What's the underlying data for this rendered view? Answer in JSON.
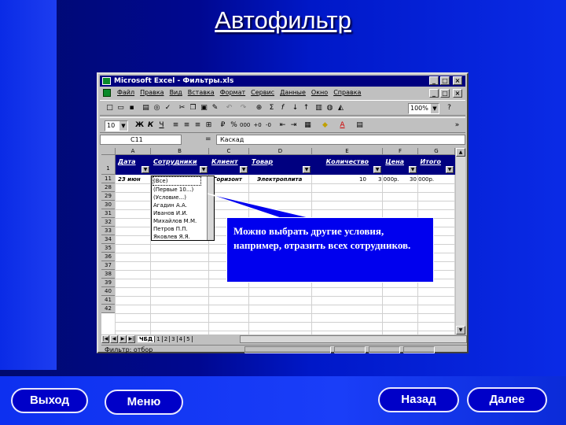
{
  "slide": {
    "title": "Автофильтр",
    "callout_text": " Можно выбрать другие условия, например, отразить всех сотрудников."
  },
  "nav": {
    "exit_label": "Выход",
    "menu_label": "Меню",
    "back_label": "Назад",
    "next_label": "Далее"
  },
  "excel": {
    "window_title": "Microsoft Excel - Фильтры.xls",
    "menu_items": [
      "Файл",
      "Правка",
      "Вид",
      "Вставка",
      "Формат",
      "Сервис",
      "Данные",
      "Окно",
      "Справка"
    ],
    "zoom": "100%",
    "font_size": "10",
    "name_box": "C11",
    "formula": "Каскад",
    "columns": [
      "A",
      "B",
      "C",
      "D",
      "E",
      "F",
      "G"
    ],
    "rows": [
      "1",
      "11",
      "28",
      "29",
      "30",
      "31",
      "32",
      "33",
      "34",
      "35",
      "36",
      "37",
      "38",
      "39",
      "40",
      "41",
      "42"
    ],
    "headers": [
      "Дата",
      "Сотрудники",
      "Клиент",
      "Товар",
      "Количество",
      "Цена",
      "Итого"
    ],
    "data_row": {
      "date": "23 июн",
      "client": "Горизонт",
      "product": "Электроплита",
      "qty": "10",
      "price": "3 000р.",
      "total": "30 000р."
    },
    "dropdown_items": [
      "(Все)",
      "(Первые 10...)",
      "(Условие...)",
      "Агадин А.А.",
      "Иванов И.И.",
      "Михайлов М.М.",
      "Петров П.П.",
      "Яковлев Я.Я."
    ],
    "sheet_tabs": [
      "ЧБД",
      "1",
      "2",
      "3",
      "4",
      "5"
    ],
    "status_text": "Фильтр: отбор"
  }
}
